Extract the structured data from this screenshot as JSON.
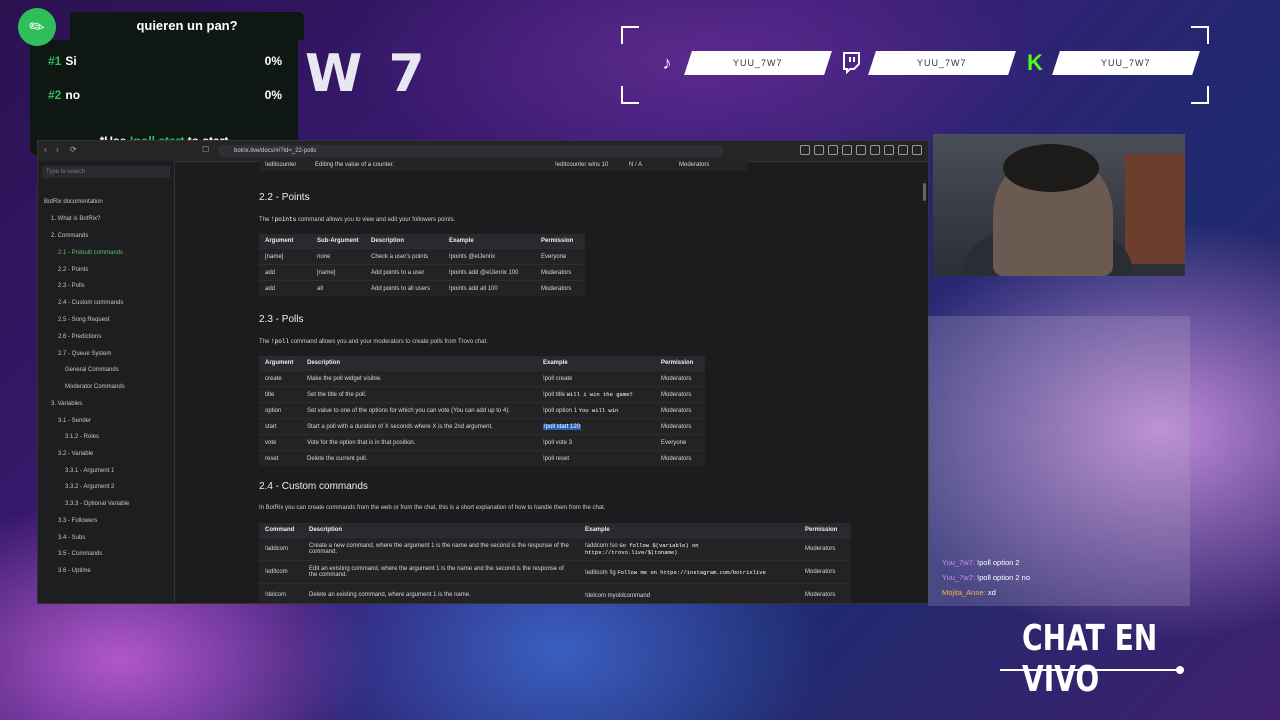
{
  "poll": {
    "title": "quieren un pan?",
    "options": [
      {
        "num": "#1",
        "label": "Si",
        "pct": "0%"
      },
      {
        "num": "#2",
        "label": "no",
        "pct": "0%"
      }
    ],
    "hint_prefix": "*Use ",
    "hint_cmd": "!poll start",
    "hint_suffix": " to start"
  },
  "bg_text": "W 7",
  "social": [
    {
      "icon": "tiktok-icon",
      "handle": "YUU_7W7"
    },
    {
      "icon": "twitch-icon",
      "handle": "YUU_7W7"
    },
    {
      "icon": "kick-icon",
      "handle": "YUU_7W7"
    }
  ],
  "browser": {
    "url": "botrix.live/docs/#/?id=_22-polls",
    "search_placeholder": "Type to search",
    "sidebar": [
      {
        "label": "BotRix documentation",
        "indent": 0,
        "active": false
      },
      {
        "label": "1. What is BotRix?",
        "indent": 1,
        "active": false
      },
      {
        "label": "2. Commands",
        "indent": 1,
        "active": false
      },
      {
        "label": "2.1 - Prebuilt commands",
        "indent": 2,
        "active": true
      },
      {
        "label": "2.2 - Points",
        "indent": 2,
        "active": false
      },
      {
        "label": "2.3 - Polls",
        "indent": 2,
        "active": false
      },
      {
        "label": "2.4 - Custom commands",
        "indent": 2,
        "active": false
      },
      {
        "label": "2.5 - Song Request",
        "indent": 2,
        "active": false
      },
      {
        "label": "2.6 - Predictions",
        "indent": 2,
        "active": false
      },
      {
        "label": "2.7 - Queue System",
        "indent": 2,
        "active": false
      },
      {
        "label": "General Commands",
        "indent": 3,
        "active": false
      },
      {
        "label": "Moderator Commands",
        "indent": 3,
        "active": false
      },
      {
        "label": "3. Variables",
        "indent": 1,
        "active": false
      },
      {
        "label": "3.1 - Sender",
        "indent": 2,
        "active": false
      },
      {
        "label": "3.1.2 - Roles",
        "indent": 3,
        "active": false
      },
      {
        "label": "3.2 - Variable",
        "indent": 2,
        "active": false
      },
      {
        "label": "3.3.1 - Argument 1",
        "indent": 3,
        "active": false
      },
      {
        "label": "3.3.2 - Argument 2",
        "indent": 3,
        "active": false
      },
      {
        "label": "3.3.3 - Optional Variable",
        "indent": 3,
        "active": false
      },
      {
        "label": "3.3 - Followers",
        "indent": 2,
        "active": false
      },
      {
        "label": "3.4 - Subs",
        "indent": 2,
        "active": false
      },
      {
        "label": "3.5 - Commands",
        "indent": 2,
        "active": false
      },
      {
        "label": "3.6 - Uptime",
        "indent": 2,
        "active": false
      }
    ],
    "top_row": {
      "cmd": "!editcounter",
      "desc": "Editing the value of a counter.",
      "example": "!editcounter wins 10",
      "sub": "N / A",
      "perm": "Moderators"
    },
    "points": {
      "heading": "2.2 - Points",
      "para_a": "The ",
      "para_code": "!points",
      "para_b": " command allows you to view and edit your followers points.",
      "headers": [
        "Argument",
        "Sub-Argument",
        "Description",
        "Example",
        "Permission"
      ],
      "rows": [
        [
          "[name]",
          "none",
          "Check a user's points",
          "!points @elJenrix",
          "Everyone"
        ],
        [
          "add",
          "[name]",
          "Add points to a user",
          "!points add @elJenrix 100",
          "Moderators"
        ],
        [
          "add",
          "all",
          "Add points to all users",
          "!points add all 100",
          "Moderators"
        ]
      ]
    },
    "polls": {
      "heading": "2.3 - Polls",
      "para_a": "The ",
      "para_code": "!poll",
      "para_b": " command allows you and your moderators to create polls from Trovo chat.",
      "headers": [
        "Argument",
        "Description",
        "Example",
        "Permission"
      ],
      "rows": [
        {
          "arg": "create",
          "desc": "Make the poll widget visible.",
          "ex": "!poll create",
          "ex_code": "",
          "perm": "Moderators"
        },
        {
          "arg": "title",
          "desc": "Set the title of the poll.",
          "ex": "!poll title ",
          "ex_code": "Will i win the game?",
          "perm": "Moderators"
        },
        {
          "arg": "option",
          "desc": "Set value to one of the options for which you can vote (You can add up to 4).",
          "ex": "!poll option 1 ",
          "ex_code": "You will win",
          "perm": "Moderators"
        },
        {
          "arg": "start",
          "desc": "Start a poll with a duration of X seconds where X is the 2nd argument.",
          "ex": "!poll start 120",
          "ex_code": "",
          "perm": "Moderators"
        },
        {
          "arg": "vote",
          "desc": "Vote for the option that is in that position.",
          "ex": "!poll vote 3",
          "ex_code": "",
          "perm": "Everyone"
        },
        {
          "arg": "reset",
          "desc": "Delete the current poll.",
          "ex": "!poll reset",
          "ex_code": "",
          "perm": "Moderators"
        }
      ]
    },
    "custom": {
      "heading": "2.4 - Custom commands",
      "para": "In BotRix you can create commands from the web or from the chat, this is a short explanation of how to handle them from the chat.",
      "headers": [
        "Command",
        "Description",
        "Example",
        "Permission"
      ],
      "rows": [
        {
          "cmd": "!addcom",
          "desc": "Create a new command, where the argument 1 is the name and the second is the response of the command.",
          "ex": "!addcom !so ",
          "ex_code": "Go follow $(variable) on https://trovo.live/$(toname)",
          "perm": "Moderators"
        },
        {
          "cmd": "!editcom",
          "desc": "Edit an existing command, where the argument 1 is the name and the second is the response of the command.",
          "ex": "!editcom !ig ",
          "ex_code": "Follow me on https://instagram.com/botrixlive",
          "perm": "Moderators"
        },
        {
          "cmd": "!delcom",
          "desc": "Delete an existing command, where argument 1 is the name.",
          "ex": "!delcom myoldcommand",
          "ex_code": "",
          "perm": "Moderators"
        }
      ]
    }
  },
  "chat": {
    "title": "CHAT EN VIVO",
    "messages": [
      {
        "user": "Yuu_7w7:",
        "text": "!poll option 2"
      },
      {
        "user": "Yuu_7w7:",
        "text": "!poll option 2 no"
      },
      {
        "user": "Mojita_Anne:",
        "text": "xd"
      }
    ]
  }
}
